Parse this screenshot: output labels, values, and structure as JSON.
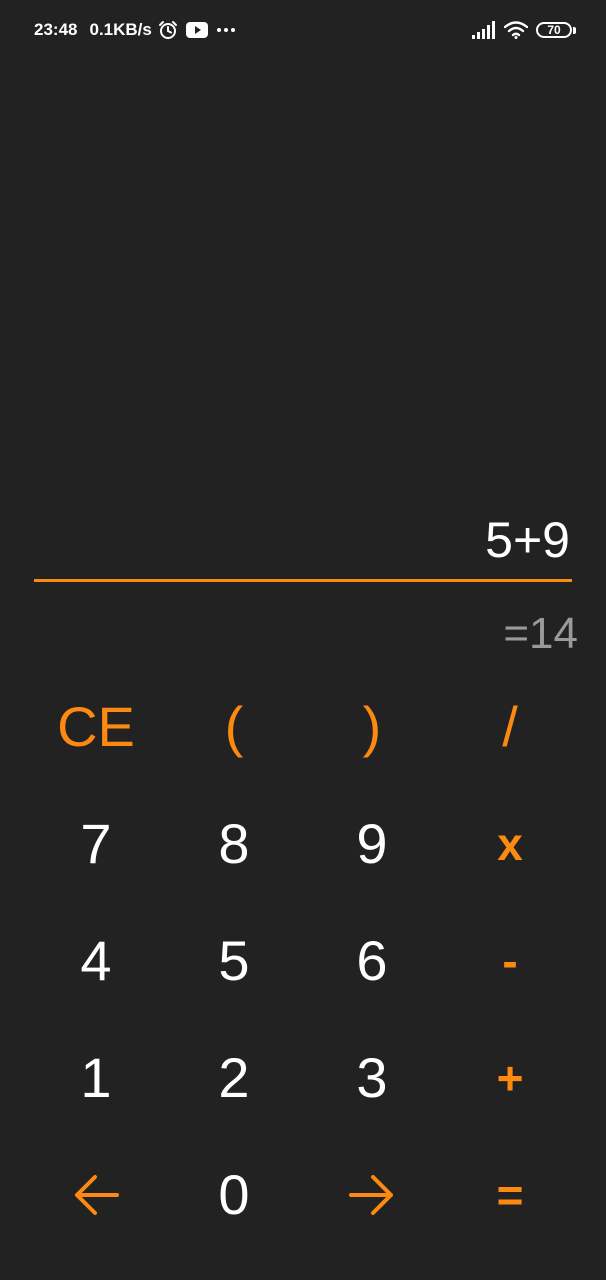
{
  "status_bar": {
    "time": "23:48",
    "network_speed": "0.1KB/s",
    "battery_level": "70",
    "icons": [
      "alarm-icon",
      "youtube-icon",
      "more-dots-icon",
      "signal-icon",
      "wifi-icon",
      "battery-icon"
    ]
  },
  "display": {
    "expression": "5+9",
    "result": "=14"
  },
  "colors": {
    "background": "#222222",
    "accent": "#fd8a10",
    "text": "#ffffff",
    "result_text": "#9a9a9a"
  },
  "keypad": {
    "row1": {
      "clear": "CE",
      "open_paren": "(",
      "close_paren": ")",
      "divide": "/"
    },
    "row2": {
      "seven": "7",
      "eight": "8",
      "nine": "9",
      "multiply": "x"
    },
    "row3": {
      "four": "4",
      "five": "5",
      "six": "6",
      "subtract": "-"
    },
    "row4": {
      "one": "1",
      "two": "2",
      "three": "3",
      "add": "+"
    },
    "row5": {
      "left_arrow_icon": "arrow-left-icon",
      "zero": "0",
      "right_arrow_icon": "arrow-right-icon",
      "equals": "="
    }
  }
}
